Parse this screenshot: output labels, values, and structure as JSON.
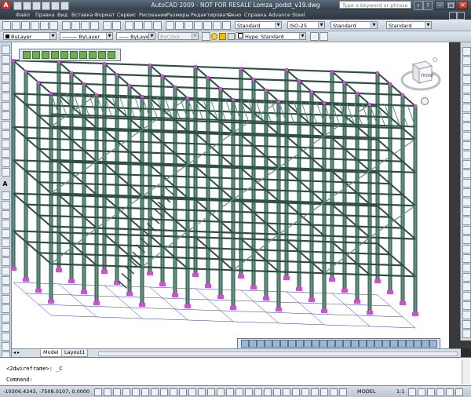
{
  "titlebar": {
    "app_title": "AutoCAD 2009 - NOT FOR RESALE",
    "file_name": "Lomza_podst_v19.dwg",
    "search_placeholder": "Type a keyword or phrase",
    "app_icon_letter": "A"
  },
  "menubar": {
    "items": [
      "Файл",
      "Правка",
      "Вид",
      "Вставка",
      "Формат",
      "Сервис",
      "Рисование",
      "Размеры",
      "Редактировать",
      "Окно",
      "Справка",
      "Advance Steel"
    ]
  },
  "toolbar1": {
    "text_style": "Standard",
    "dim_style": "ISO-25",
    "table_style": "Standard",
    "multileader_style": "Standard"
  },
  "toolbar2": {
    "color": "ByLayer",
    "linetype": "ByLayer",
    "lineweight": "ByLayer",
    "plot_style": "ByColor",
    "layer": "Hype_Standard"
  },
  "viewcube": {
    "face": "FRONT"
  },
  "tabs": [
    "Model",
    "Layout1"
  ],
  "active_tab": "Model",
  "command": {
    "history": "<2dwireframe>: _C",
    "prompt": "Command:"
  },
  "status": {
    "coordinates": "-10306.4243, -7508.0107, 0.0000",
    "model_label": "MODEL",
    "scale": "1:1"
  },
  "colors": {
    "steel": "#5f8f7e",
    "steel_dark": "#2f4f45",
    "connection": "#d14fd1",
    "grid": "#3030c8"
  }
}
